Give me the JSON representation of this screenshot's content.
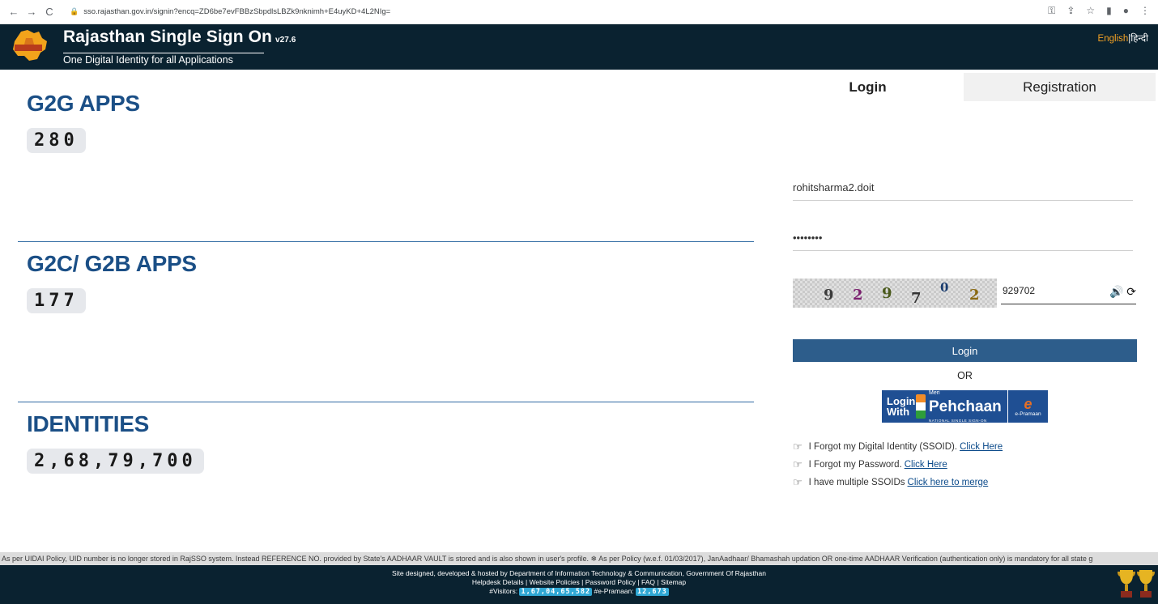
{
  "browser": {
    "url": "sso.rajasthan.gov.in/signin?encq=ZD6be7evFBBzSbpdlsLBZk9nknimh+E4uyKD+4L2NIg="
  },
  "header": {
    "logo_text": "Rajasthan SSO",
    "title": "Rajasthan Single Sign On",
    "version": "v27.6",
    "subtitle": "One Digital Identity for all Applications",
    "lang_english": "English",
    "lang_sep": "|",
    "lang_hindi": "हिन्दी"
  },
  "stats": [
    {
      "title": "G2G APPS",
      "value": "280"
    },
    {
      "title": "G2C/ G2B APPS",
      "value": "177"
    },
    {
      "title": "IDENTITIES",
      "value": "2,68,79,700"
    }
  ],
  "auth": {
    "tab_login": "Login",
    "tab_registration": "Registration",
    "username": "rohitsharma2.doit",
    "password_mask": "••••••••",
    "captcha_digits": [
      "9",
      "2",
      "9",
      "7",
      "0",
      "2"
    ],
    "captcha_input": "929702",
    "login_button": "Login",
    "or_text": "OR",
    "mp_login_with": "Login With",
    "mp_meri": "Meri",
    "mp_pehchaan": "Pehchaan",
    "mp_tagline": "NATIONAL SINGLE SIGN-ON",
    "mp_epramaan": "e-Pramaan"
  },
  "help_links": [
    {
      "text": "I Forgot my Digital Identity (SSOID).",
      "link": "Click Here"
    },
    {
      "text": "I Forgot my Password.",
      "link": "Click Here"
    },
    {
      "text": "I have multiple SSOIDs",
      "link": "Click here to merge"
    }
  ],
  "ticker": "As per UIDAI Policy, UID number is no longer stored in RajSSO system. Instead REFERENCE NO. provided by State's AADHAAR VAULT is stored and is also shown in user's profile.    ❄ As per Policy (w.e.f. 01/03/2017), JanAadhaar/ Bhamashah updation OR one-time AADHAAR Verification (authentication only) is mandatory for all state g",
  "footer": {
    "line1": "Site designed, developed & hosted by Department of Information Technology & Communication, Government Of Rajasthan",
    "links": [
      "Helpdesk Details",
      "Website Policies",
      "Password Policy",
      "FAQ",
      "Sitemap"
    ],
    "visitors_label": "#Visitors:",
    "visitors_value": "1,67,04,65,582",
    "epramaan_label": "#e-Pramaan:",
    "epramaan_value": "12,673"
  },
  "colors": {
    "header_bg": "#0a2230",
    "stat_title": "#1b4f86",
    "login_button": "#2d5d8b",
    "accent_orange": "#f4a223"
  }
}
